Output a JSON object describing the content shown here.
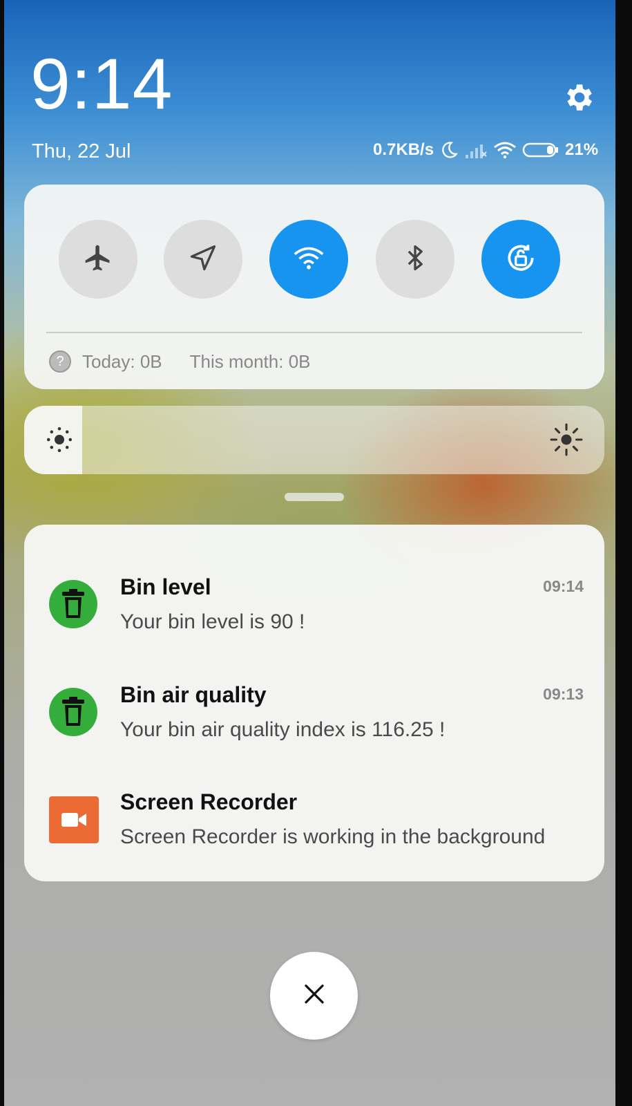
{
  "header": {
    "time": "9:14",
    "date": "Thu, 22 Jul",
    "network_speed": "0.7KB/s",
    "battery": "21%",
    "settings_icon": "gear-icon"
  },
  "quick_settings": {
    "toggles": [
      {
        "name": "airplane-mode",
        "icon": "airplane-icon",
        "on": false
      },
      {
        "name": "location",
        "icon": "navigation-arrow-icon",
        "on": false
      },
      {
        "name": "wifi",
        "icon": "wifi-icon",
        "on": true
      },
      {
        "name": "bluetooth",
        "icon": "bluetooth-icon",
        "on": false
      },
      {
        "name": "auto-rotate-lock",
        "icon": "rotation-lock-icon",
        "on": true
      }
    ],
    "today_usage": "Today: 0B",
    "month_usage": "This month: 0B",
    "active_color": "#1793f0"
  },
  "brightness": {
    "level": 0.1
  },
  "notifications": [
    {
      "title": "Bin level",
      "body": "Your bin level is 90 !",
      "time": "09:14",
      "icon": "trash-bin-icon",
      "icon_color": "#34ad3c"
    },
    {
      "title": "Bin air quality",
      "body": "Your bin air quality index is 116.25 !",
      "time": "09:13",
      "icon": "trash-bin-icon",
      "icon_color": "#34ad3c"
    },
    {
      "title": "Screen Recorder",
      "body": "Screen Recorder is working in the background",
      "time": "",
      "icon": "video-camera-icon",
      "icon_color": "#ec6a34"
    }
  ],
  "close_button": {
    "icon": "close-icon"
  }
}
